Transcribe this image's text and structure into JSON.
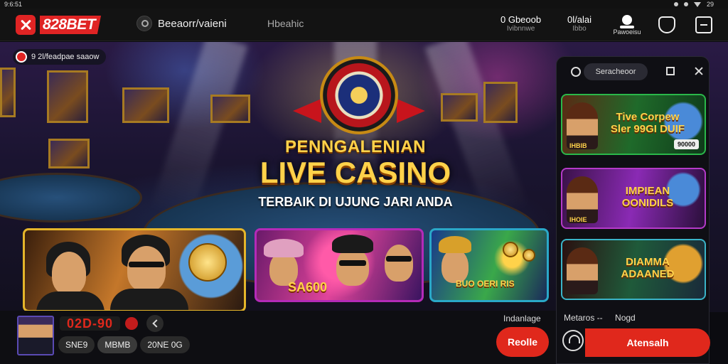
{
  "status_bar": {
    "time": "9:6:51",
    "battery": "29"
  },
  "header": {
    "brand": "828BET",
    "search_text": "Beeaorr/vaieni",
    "nav_link": "Hbeahic",
    "stats": [
      {
        "value": "0 Gbeoob",
        "label": "Ivibnnwe"
      },
      {
        "value": "0l/alai",
        "label": "Ibbo"
      }
    ],
    "user_label": "Pawoeisu"
  },
  "hero": {
    "live_badge": "9 2l/feadpae saaow",
    "headline_top": "PENNGALENIAN",
    "headline_main": "LIVE CASINO",
    "headline_sub": "TERBAIK DI UJUNG JARI ANDA",
    "cards": [
      {
        "label": ""
      },
      {
        "label": "SA600"
      },
      {
        "label": "BUO OERI RIS"
      }
    ]
  },
  "side_panel": {
    "search_label": "Seracheoor",
    "cards": [
      {
        "title": "Tive Corpew Sler 99GI DUIF",
        "tag": "IHBIB",
        "pill": "90000"
      },
      {
        "title": "IMPIEAN OONIDILS",
        "tag": "IHOIE",
        "pill": ""
      },
      {
        "title": "DIAMMA ADAANED",
        "tag": "",
        "pill": ""
      }
    ],
    "footer_left": "Metaros --",
    "footer_right": "Nogd",
    "cta_label": "Atensalh"
  },
  "bottom_bar": {
    "score": "02D-90",
    "chips": [
      "SNE9",
      "MBMB",
      "20NE 0G"
    ],
    "right_label": "Indanlage",
    "reload_label": "Reolle"
  },
  "colors": {
    "brand_red": "#e0281c",
    "gold": "#ffd24a",
    "panel_bg": "#0f0f14"
  }
}
